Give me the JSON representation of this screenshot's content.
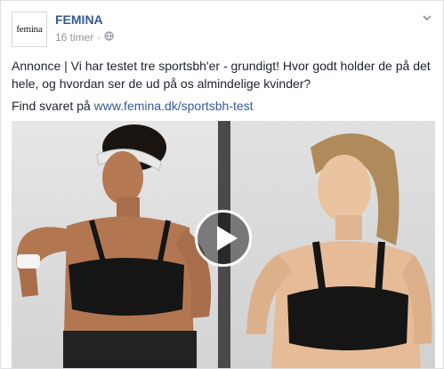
{
  "post": {
    "page_name": "FEMINA",
    "avatar_text": "femina",
    "timestamp": "16 timer",
    "separator": "·",
    "audience_icon": "globe-icon",
    "menu_icon": "chevron-down-icon",
    "text": "Annonce | Vi har testet tre sportsbh'er - grundigt! Hvor godt holder de på det hele, og hvordan ser de ud på os almindelige kvinder?",
    "link_prefix": "Find svaret på ",
    "link_text": "www.femina.dk/sportsbh-test"
  },
  "media": {
    "type": "video",
    "play_icon": "play-icon"
  },
  "colors": {
    "link": "#365899",
    "text": "#1d2129",
    "meta": "#90949c",
    "sports_bra": "#151515",
    "divider": "#4a4a4a"
  }
}
